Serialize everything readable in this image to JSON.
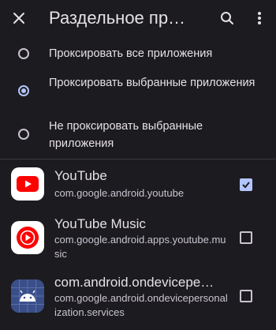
{
  "appbar": {
    "title": "Раздельное пр…",
    "close_icon": "close-icon",
    "search_icon": "search-icon",
    "more_icon": "more-vert-icon"
  },
  "mode_options": [
    {
      "label": "Проксировать все приложения",
      "selected": false
    },
    {
      "label": "Проксировать выбранные приложения",
      "selected": true
    },
    {
      "label": "Не проксировать выбранные приложения",
      "selected": false
    }
  ],
  "apps": [
    {
      "name": "YouTube",
      "package": "com.google.android.youtube",
      "checked": true,
      "icon": "youtube-icon"
    },
    {
      "name": "YouTube Music",
      "package": "com.google.android.apps.youtube.music",
      "checked": false,
      "icon": "youtube-music-icon"
    },
    {
      "name": "com.android.ondevicepe…",
      "package": "com.google.android.ondevicepersonalization.services",
      "checked": false,
      "icon": "android-icon"
    }
  ],
  "colors": {
    "background": "#1c1b1f",
    "accent": "#b3c5ff",
    "youtube_red": "#ff0000"
  }
}
